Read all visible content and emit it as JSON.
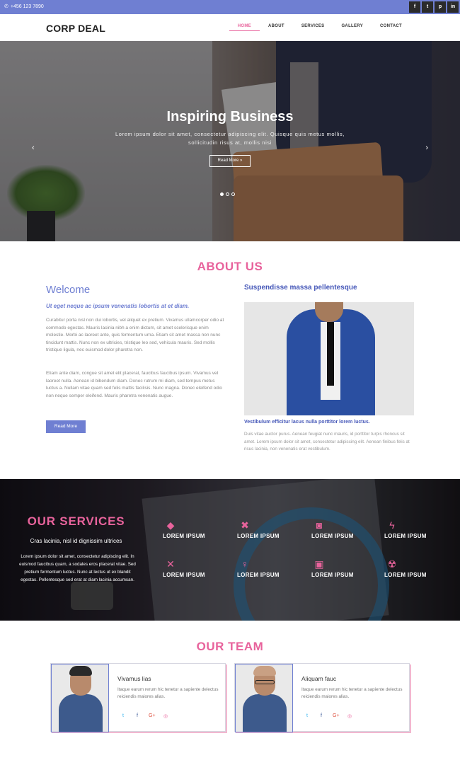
{
  "topbar": {
    "phone": "+456 123 7890",
    "social": [
      "f",
      "t",
      "p",
      "in"
    ]
  },
  "header": {
    "logo": "CORP DEAL",
    "nav": [
      "HOME",
      "ABOUT",
      "SERVICES",
      "GALLERY",
      "CONTACT"
    ],
    "active_nav": "HOME"
  },
  "hero": {
    "title": "Inspiring Business",
    "text": "Lorem ipsum dolor sit amet, consectetur adipiscing elit. Quisque quis metus mollis, sollicitudin risus at, mollis nisi",
    "button": "Read More »",
    "slides": 3,
    "active_slide": 1
  },
  "about": {
    "title": "ABOUT US",
    "welcome": "Welcome",
    "subtitle": "Ut eget neque ac ipsum venenatis lobortis at et diam.",
    "p1": "Curabitur porta nisl non dui lobortis, vel aliquet ex pretium. Vivamus ullamcorper odio at commodo egestas. Mauris lacinia nibh a enim dictum, sit amet scelerisque enim molestie. Morbi ac laoreet ante, quis fermentum urna. Etiam sit amet massa non nunc tincidunt mattis. Nunc non ex ultricies, tristique leo sed, vehicula mauris. Sed mollis tristique ligula, nec euismod dolor pharetra non.",
    "p2": "Etiam ante diam, congue sit amet elit placerat, faucibus faucibus ipsum. Vivamus vel laoreet nulla. Aenean id bibendum diam. Donec rutrum mi diam, sed tempus metus luctus a. Nullam vitae quam sed felis mattis facilisis. Nunc magna. Donec eleifend odio non neque semper eleifend. Mauris pharetra venenatis augue.",
    "button": "Read More",
    "right_title": "Suspendisse massa pellentesque",
    "caption": "Vestibulum efficitur lacus nulla porttitor lorem luctus.",
    "caption_text": "Duis vitae auctor purus. Aenean feugiat nunc mauris, id porttitor turpis rhoncus sit amet. Lorem ipsum dolor sit amet, consectetur adipiscing elit. Aenean finibus felis at risus lacinia, non venenatis erat vestibulum."
  },
  "services": {
    "title": "OUR SERVICES",
    "subtitle": "Cras lacinia, nisl id dignissim ultrices",
    "text": "Lorem ipsum dolor sit amet, consectetur adipiscing elit. In euismod faucibus quam, a sodales eros placerat vitae. Sed pretium fermentum luctus. Nunc at lectus ut ex blandit egestas. Pellentesque sed erat at diam lacinia accumsan.",
    "items": [
      {
        "label": "LOREM IPSUM",
        "icon": "diamond-icon",
        "glyph": "◆"
      },
      {
        "label": "LOREM IPSUM",
        "icon": "x-cross-icon",
        "glyph": "✖"
      },
      {
        "label": "LOREM IPSUM",
        "icon": "car-icon",
        "glyph": "◙"
      },
      {
        "label": "LOREM IPSUM",
        "icon": "bolt-icon",
        "glyph": "ϟ"
      },
      {
        "label": "LOREM IPSUM",
        "icon": "tools-icon",
        "glyph": "✕"
      },
      {
        "label": "LOREM IPSUM",
        "icon": "female-icon",
        "glyph": "♀"
      },
      {
        "label": "LOREM IPSUM",
        "icon": "shopping-bag-icon",
        "glyph": "▣"
      },
      {
        "label": "LOREM IPSUM",
        "icon": "radiation-icon",
        "glyph": "☢"
      }
    ]
  },
  "team": {
    "title": "OUR TEAM",
    "members": [
      {
        "name": "Vivamus lias",
        "bio": "Itaque earum rerum hic tenetur a sapiente delectus reiciendis maiores alias."
      },
      {
        "name": "Aliquam fauc",
        "bio": "Itaque earum rerum hic tenetur a sapiente delectus reiciendis maiores alias."
      }
    ],
    "social": [
      "t",
      "f",
      "G+",
      "◎"
    ]
  },
  "colors": {
    "accent_pink": "#e8639c",
    "accent_blue": "#6f7fd2",
    "heading_blue": "#4557b8"
  }
}
